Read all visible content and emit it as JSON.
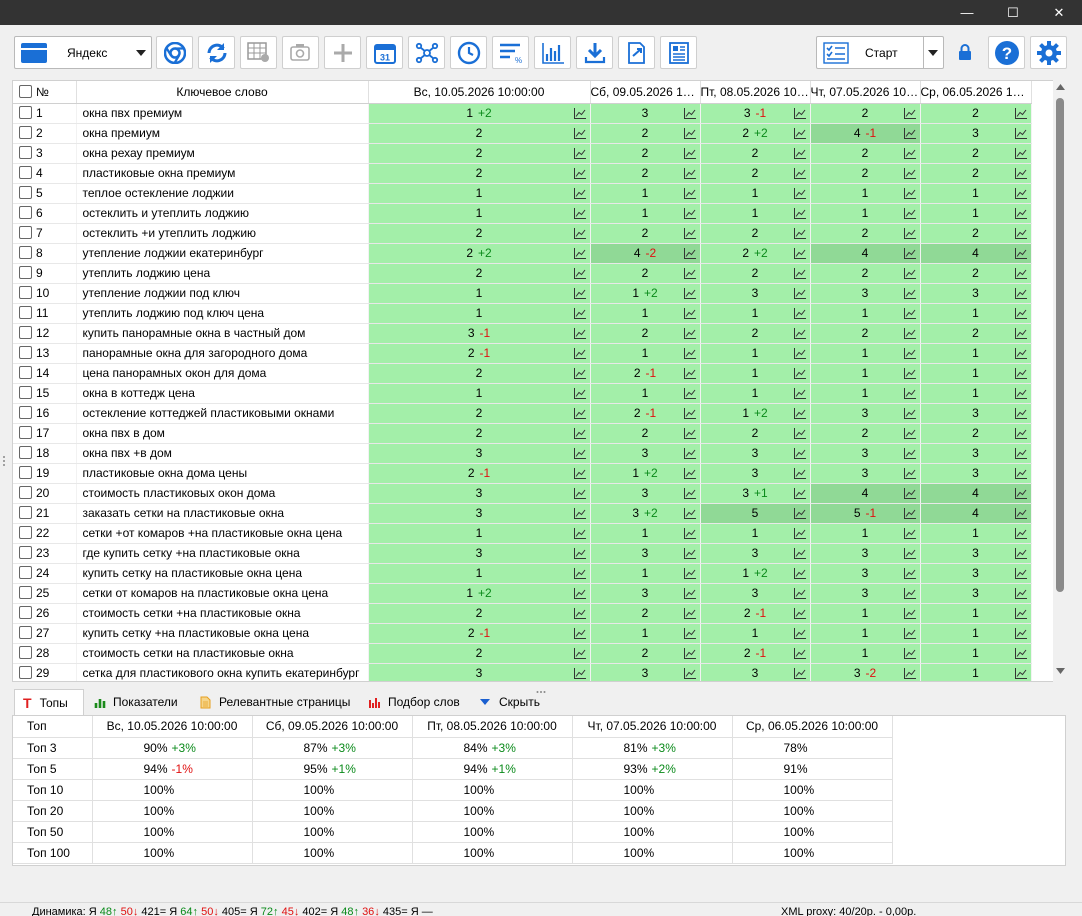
{
  "window": {
    "minimize": "—",
    "maximize": "☐",
    "close": "✕"
  },
  "toolbar": {
    "engine": "Яндекс",
    "start_label": "Старт",
    "calendar_day": "31",
    "icons": [
      "chrome-icon",
      "refresh-icon",
      "table-settings-icon",
      "camera-settings-icon",
      "add-icon",
      "calendar-icon",
      "cluster-icon",
      "clock-icon",
      "sort-percent-icon",
      "bar-chart-icon",
      "download-icon",
      "export-icon",
      "report-icon"
    ]
  },
  "grid": {
    "headers": {
      "num": "№",
      "keyword": "Ключевое слово"
    },
    "dates": [
      "Вс, 10.05.2026 10:00:00",
      "Сб, 09.05.2026 10:00:00",
      "Пт, 08.05.2026 10:00:00",
      "Чт, 07.05.2026 10:00:00",
      "Ср, 06.05.2026 10:00:00"
    ],
    "rows": [
      {
        "n": "1",
        "kw": "окна пвх премиум",
        "c": [
          [
            "1",
            "+2"
          ],
          [
            "3",
            ""
          ],
          [
            "3",
            "-1"
          ],
          [
            "2",
            ""
          ],
          [
            "2",
            ""
          ]
        ]
      },
      {
        "n": "2",
        "kw": "окна премиум",
        "c": [
          [
            "2",
            ""
          ],
          [
            "2",
            ""
          ],
          [
            "2",
            "+2"
          ],
          [
            "4",
            "-1"
          ],
          [
            "3",
            ""
          ]
        ]
      },
      {
        "n": "3",
        "kw": "окна рехау премиум",
        "c": [
          [
            "2",
            ""
          ],
          [
            "2",
            ""
          ],
          [
            "2",
            ""
          ],
          [
            "2",
            ""
          ],
          [
            "2",
            ""
          ]
        ]
      },
      {
        "n": "4",
        "kw": "пластиковые окна премиум",
        "c": [
          [
            "2",
            ""
          ],
          [
            "2",
            ""
          ],
          [
            "2",
            ""
          ],
          [
            "2",
            ""
          ],
          [
            "2",
            ""
          ]
        ]
      },
      {
        "n": "5",
        "kw": "теплое остекление лоджии",
        "c": [
          [
            "1",
            ""
          ],
          [
            "1",
            ""
          ],
          [
            "1",
            ""
          ],
          [
            "1",
            ""
          ],
          [
            "1",
            ""
          ]
        ]
      },
      {
        "n": "6",
        "kw": "остеклить и утеплить лоджию",
        "c": [
          [
            "1",
            ""
          ],
          [
            "1",
            ""
          ],
          [
            "1",
            ""
          ],
          [
            "1",
            ""
          ],
          [
            "1",
            ""
          ]
        ]
      },
      {
        "n": "7",
        "kw": "остеклить +и утеплить лоджию",
        "c": [
          [
            "2",
            ""
          ],
          [
            "2",
            ""
          ],
          [
            "2",
            ""
          ],
          [
            "2",
            ""
          ],
          [
            "2",
            ""
          ]
        ]
      },
      {
        "n": "8",
        "kw": "утепление лоджии екатеринбург",
        "c": [
          [
            "2",
            "+2"
          ],
          [
            "4",
            "-2"
          ],
          [
            "2",
            "+2"
          ],
          [
            "4",
            ""
          ],
          [
            "4",
            ""
          ]
        ]
      },
      {
        "n": "9",
        "kw": "утеплить лоджию цена",
        "c": [
          [
            "2",
            ""
          ],
          [
            "2",
            ""
          ],
          [
            "2",
            ""
          ],
          [
            "2",
            ""
          ],
          [
            "2",
            ""
          ]
        ]
      },
      {
        "n": "10",
        "kw": "утепление лоджии под ключ",
        "c": [
          [
            "1",
            ""
          ],
          [
            "1",
            "+2"
          ],
          [
            "3",
            ""
          ],
          [
            "3",
            ""
          ],
          [
            "3",
            ""
          ]
        ]
      },
      {
        "n": "11",
        "kw": "утеплить лоджию под ключ цена",
        "c": [
          [
            "1",
            ""
          ],
          [
            "1",
            ""
          ],
          [
            "1",
            ""
          ],
          [
            "1",
            ""
          ],
          [
            "1",
            ""
          ]
        ]
      },
      {
        "n": "12",
        "kw": "купить панорамные окна в частный дом",
        "c": [
          [
            "3",
            "-1"
          ],
          [
            "2",
            ""
          ],
          [
            "2",
            ""
          ],
          [
            "2",
            ""
          ],
          [
            "2",
            ""
          ]
        ]
      },
      {
        "n": "13",
        "kw": "панорамные окна для загородного дома",
        "c": [
          [
            "2",
            "-1"
          ],
          [
            "1",
            ""
          ],
          [
            "1",
            ""
          ],
          [
            "1",
            ""
          ],
          [
            "1",
            ""
          ]
        ]
      },
      {
        "n": "14",
        "kw": "цена панорамных окон для дома",
        "c": [
          [
            "2",
            ""
          ],
          [
            "2",
            "-1"
          ],
          [
            "1",
            ""
          ],
          [
            "1",
            ""
          ],
          [
            "1",
            ""
          ]
        ]
      },
      {
        "n": "15",
        "kw": "окна в коттедж цена",
        "c": [
          [
            "1",
            ""
          ],
          [
            "1",
            ""
          ],
          [
            "1",
            ""
          ],
          [
            "1",
            ""
          ],
          [
            "1",
            ""
          ]
        ]
      },
      {
        "n": "16",
        "kw": "остекление коттеджей пластиковыми окнами",
        "c": [
          [
            "2",
            ""
          ],
          [
            "2",
            "-1"
          ],
          [
            "1",
            "+2"
          ],
          [
            "3",
            ""
          ],
          [
            "3",
            ""
          ]
        ]
      },
      {
        "n": "17",
        "kw": "окна пвх в дом",
        "c": [
          [
            "2",
            ""
          ],
          [
            "2",
            ""
          ],
          [
            "2",
            ""
          ],
          [
            "2",
            ""
          ],
          [
            "2",
            ""
          ]
        ]
      },
      {
        "n": "18",
        "kw": "окна пвх +в дом",
        "c": [
          [
            "3",
            ""
          ],
          [
            "3",
            ""
          ],
          [
            "3",
            ""
          ],
          [
            "3",
            ""
          ],
          [
            "3",
            ""
          ]
        ]
      },
      {
        "n": "19",
        "kw": "пластиковые окна дома цены",
        "c": [
          [
            "2",
            "-1"
          ],
          [
            "1",
            "+2"
          ],
          [
            "3",
            ""
          ],
          [
            "3",
            ""
          ],
          [
            "3",
            ""
          ]
        ]
      },
      {
        "n": "20",
        "kw": "стоимость пластиковых окон дома",
        "c": [
          [
            "3",
            ""
          ],
          [
            "3",
            ""
          ],
          [
            "3",
            "+1"
          ],
          [
            "4",
            ""
          ],
          [
            "4",
            ""
          ]
        ]
      },
      {
        "n": "21",
        "kw": "заказать сетки на пластиковые окна",
        "c": [
          [
            "3",
            ""
          ],
          [
            "3",
            "+2"
          ],
          [
            "5",
            ""
          ],
          [
            "5",
            "-1"
          ],
          [
            "4",
            ""
          ]
        ]
      },
      {
        "n": "22",
        "kw": "сетки +от комаров +на пластиковые окна цена",
        "c": [
          [
            "1",
            ""
          ],
          [
            "1",
            ""
          ],
          [
            "1",
            ""
          ],
          [
            "1",
            ""
          ],
          [
            "1",
            ""
          ]
        ]
      },
      {
        "n": "23",
        "kw": "где купить сетку +на пластиковые окна",
        "c": [
          [
            "3",
            ""
          ],
          [
            "3",
            ""
          ],
          [
            "3",
            ""
          ],
          [
            "3",
            ""
          ],
          [
            "3",
            ""
          ]
        ]
      },
      {
        "n": "24",
        "kw": "купить сетку на пластиковые окна цена",
        "c": [
          [
            "1",
            ""
          ],
          [
            "1",
            ""
          ],
          [
            "1",
            "+2"
          ],
          [
            "3",
            ""
          ],
          [
            "3",
            ""
          ]
        ]
      },
      {
        "n": "25",
        "kw": "сетки от комаров на пластиковые окна цена",
        "c": [
          [
            "1",
            "+2"
          ],
          [
            "3",
            ""
          ],
          [
            "3",
            ""
          ],
          [
            "3",
            ""
          ],
          [
            "3",
            ""
          ]
        ]
      },
      {
        "n": "26",
        "kw": "стоимость сетки +на пластиковые окна",
        "c": [
          [
            "2",
            ""
          ],
          [
            "2",
            ""
          ],
          [
            "2",
            "-1"
          ],
          [
            "1",
            ""
          ],
          [
            "1",
            ""
          ]
        ]
      },
      {
        "n": "27",
        "kw": "купить сетку +на пластиковые окна цена",
        "c": [
          [
            "2",
            "-1"
          ],
          [
            "1",
            ""
          ],
          [
            "1",
            ""
          ],
          [
            "1",
            ""
          ],
          [
            "1",
            ""
          ]
        ]
      },
      {
        "n": "28",
        "kw": "стоимость сетки на пластиковые окна",
        "c": [
          [
            "2",
            ""
          ],
          [
            "2",
            ""
          ],
          [
            "2",
            "-1"
          ],
          [
            "1",
            ""
          ],
          [
            "1",
            ""
          ]
        ]
      },
      {
        "n": "29",
        "kw": "сетка для пластикового окна купить екатеринбург",
        "c": [
          [
            "3",
            ""
          ],
          [
            "3",
            ""
          ],
          [
            "3",
            ""
          ],
          [
            "3",
            "-2"
          ],
          [
            "1",
            ""
          ]
        ]
      }
    ],
    "dark_cells": [
      [
        1,
        3
      ],
      [
        7,
        1
      ],
      [
        7,
        3
      ],
      [
        7,
        4
      ],
      [
        19,
        3
      ],
      [
        19,
        4
      ],
      [
        20,
        2
      ],
      [
        20,
        3
      ],
      [
        20,
        4
      ]
    ]
  },
  "tabs": [
    {
      "label": "Топы",
      "icon": "tops-icon",
      "color": "#e02020"
    },
    {
      "label": "Показатели",
      "icon": "indicators-icon",
      "color": "#1a8a1a"
    },
    {
      "label": "Релевантные страницы",
      "icon": "pages-icon",
      "color": "#e6a020"
    },
    {
      "label": "Подбор слов",
      "icon": "words-icon",
      "color": "#e02020"
    },
    {
      "label": "Скрыть",
      "icon": "hide-icon",
      "color": "#1a5fd0"
    }
  ],
  "tops": {
    "header_label": "Топ",
    "rows": [
      {
        "label": "Топ 3",
        "c": [
          [
            "90%",
            "+3%"
          ],
          [
            "87%",
            "+3%"
          ],
          [
            "84%",
            "+3%"
          ],
          [
            "81%",
            "+3%"
          ],
          [
            "78%",
            ""
          ]
        ]
      },
      {
        "label": "Топ 5",
        "c": [
          [
            "94%",
            "-1%"
          ],
          [
            "95%",
            "+1%"
          ],
          [
            "94%",
            "+1%"
          ],
          [
            "93%",
            "+2%"
          ],
          [
            "91%",
            ""
          ]
        ]
      },
      {
        "label": "Топ 10",
        "c": [
          [
            "100%",
            ""
          ],
          [
            "100%",
            ""
          ],
          [
            "100%",
            ""
          ],
          [
            "100%",
            ""
          ],
          [
            "100%",
            ""
          ]
        ]
      },
      {
        "label": "Топ 20",
        "c": [
          [
            "100%",
            ""
          ],
          [
            "100%",
            ""
          ],
          [
            "100%",
            ""
          ],
          [
            "100%",
            ""
          ],
          [
            "100%",
            ""
          ]
        ]
      },
      {
        "label": "Топ 50",
        "c": [
          [
            "100%",
            ""
          ],
          [
            "100%",
            ""
          ],
          [
            "100%",
            ""
          ],
          [
            "100%",
            ""
          ],
          [
            "100%",
            ""
          ]
        ]
      },
      {
        "label": "Топ 100",
        "c": [
          [
            "100%",
            ""
          ],
          [
            "100%",
            ""
          ],
          [
            "100%",
            ""
          ],
          [
            "100%",
            ""
          ],
          [
            "100%",
            ""
          ]
        ]
      }
    ]
  },
  "status": {
    "dynamics_label": "Динамика: Я",
    "groups": [
      {
        "up": "48",
        "down": "50",
        "same": "421",
        "sep": "= Я"
      },
      {
        "up": "64",
        "down": "50",
        "same": "405",
        "sep": "= Я"
      },
      {
        "up": "72",
        "down": "45",
        "same": "402",
        "sep": "= Я"
      },
      {
        "up": "48",
        "down": "36",
        "same": "435",
        "sep": "= Я —"
      }
    ],
    "proxy": "XML proxy: 40/20р. - 0,00р."
  }
}
